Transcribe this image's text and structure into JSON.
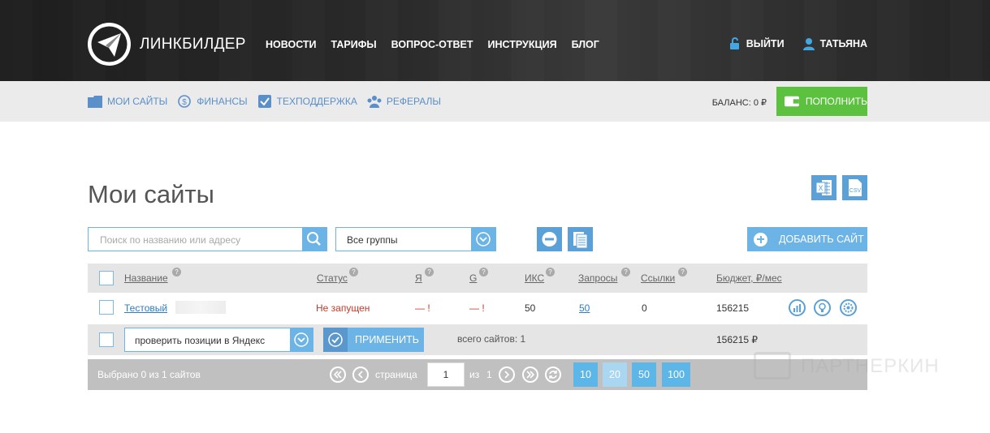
{
  "header": {
    "brand": "ЛИНКБИЛДЕР",
    "nav": [
      "НОВОСТИ",
      "ТАРИФЫ",
      "ВОПРОС-ОТВЕТ",
      "ИНСТРУКЦИЯ",
      "БЛОГ"
    ],
    "logout_label": "ВЫЙТИ",
    "user_name": "ТАТЬЯНА"
  },
  "subnav": {
    "items": [
      "МОИ САЙТЫ",
      "ФИНАНСЫ",
      "ТЕХПОДДЕРЖКА",
      "РЕФЕРАЛЫ"
    ],
    "balance": "БАЛАНС: 0 ₽",
    "topup_label": "ПОПОЛНИТЬ"
  },
  "page": {
    "title": "Мои сайты",
    "search_placeholder": "Поиск по названию или адресу",
    "group_value": "Все группы",
    "add_site_label": "ДОБАВИТЬ САЙТ",
    "export_excel_icon": "excel-export-icon",
    "export_csv_icon": "csv-export-icon"
  },
  "table": {
    "headers": [
      "Название",
      "Статус",
      "Я",
      "G",
      "ИКС",
      "Запросы",
      "Ссылки",
      "Бюджет, ₽/мес"
    ],
    "help_mark": "?",
    "rows": [
      {
        "name": "Тестовый",
        "status": "Не запущен",
        "yandex": "— !",
        "google": "— !",
        "iks": "50",
        "queries": "50",
        "links": "0",
        "budget": "156215"
      }
    ],
    "bulk_action": "проверить позиции в Яндекс",
    "apply_label": "ПРИМЕНИТЬ",
    "total_sites": "всего сайтов: 1",
    "total_budget": "156215 ₽"
  },
  "pager": {
    "selected": "Выбрано 0 из 1 сайтов",
    "page_label": "страница",
    "page_value": "1",
    "of_label": "из",
    "total_pages": "1",
    "page_sizes": [
      "10",
      "20",
      "50",
      "100"
    ],
    "active_size": "20"
  },
  "watermark": "ПАРТНЕРКИН",
  "colors": {
    "accent": "#6cb3e6",
    "green": "#5cc13f",
    "status_red": "#c43a2a"
  }
}
